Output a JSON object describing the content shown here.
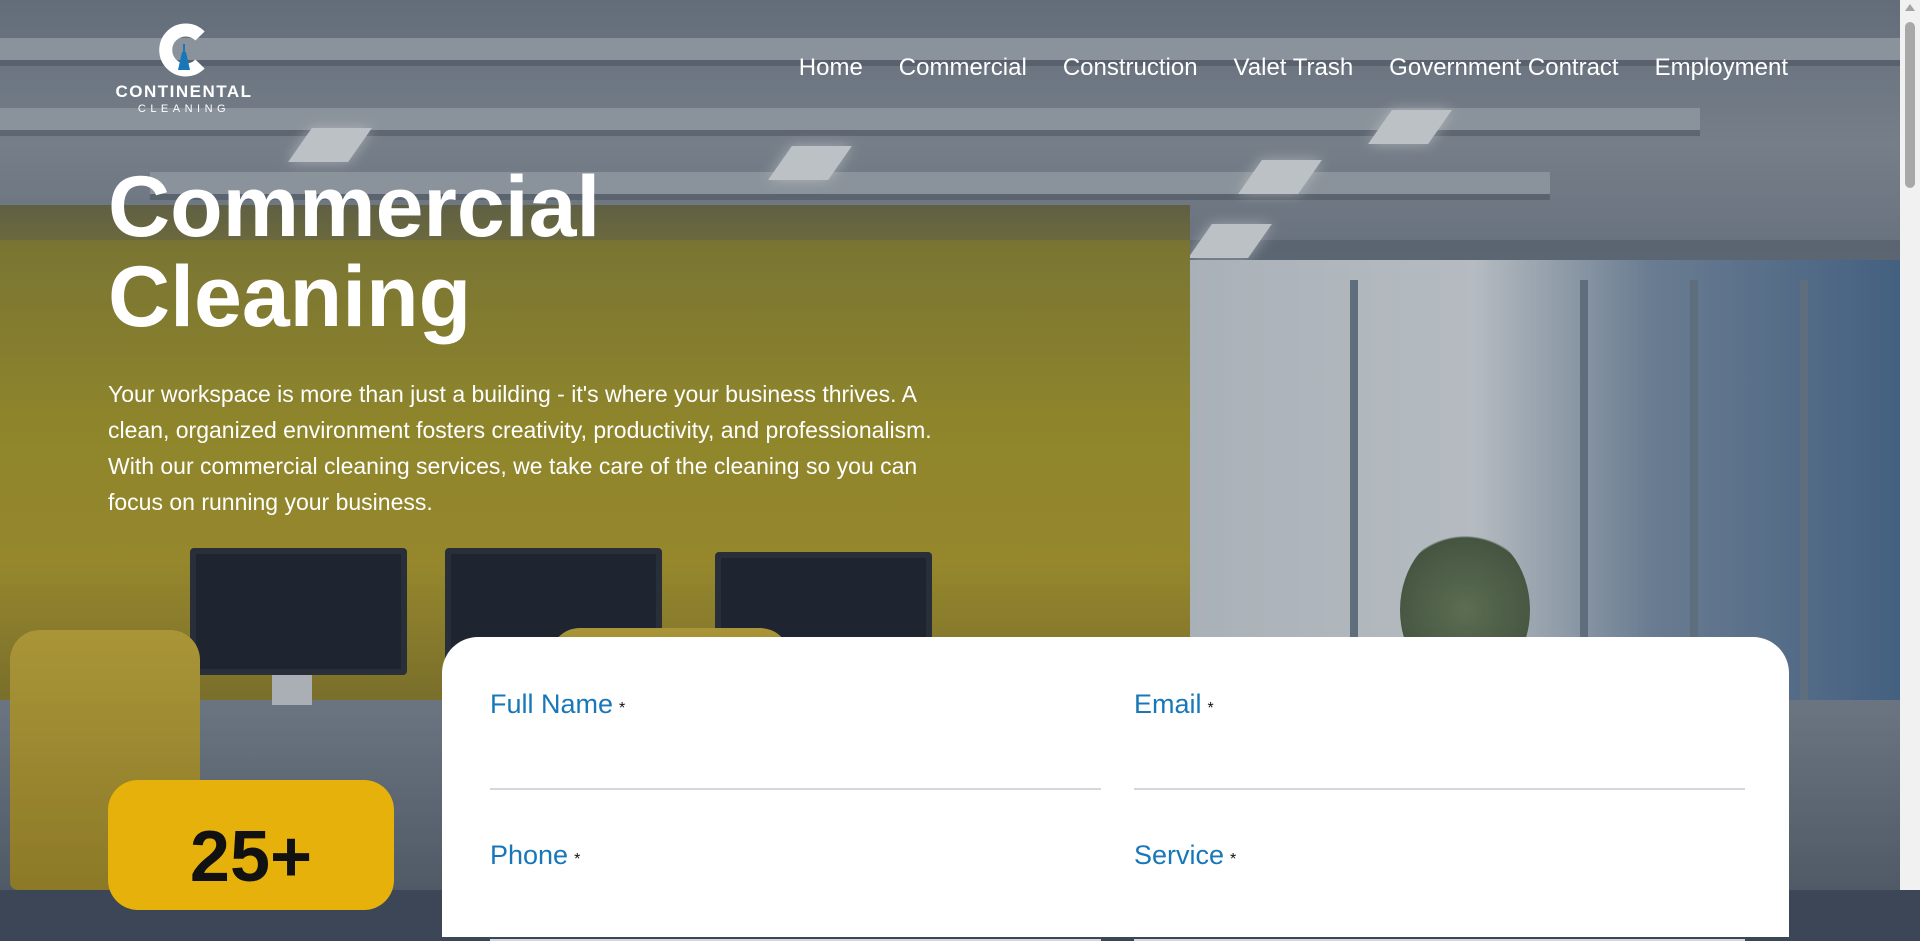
{
  "brand": {
    "name": "CONTINENTAL",
    "sub": "CLEANING",
    "accent_color": "#1877b8"
  },
  "nav": {
    "items": [
      {
        "label": "Home"
      },
      {
        "label": "Commercial"
      },
      {
        "label": "Construction"
      },
      {
        "label": "Valet Trash"
      },
      {
        "label": "Government Contract"
      },
      {
        "label": "Employment"
      }
    ]
  },
  "hero": {
    "title_line1": "Commercial",
    "title_line2": "Cleaning",
    "description": "Your workspace is more than just a building - it's where your business thrives. A clean, organized environment fosters creativity, productivity, and professionalism. With our commercial cleaning services, we take care of the cleaning so you can focus on running your business."
  },
  "stat": {
    "value": "25+",
    "color": "#e6b10a"
  },
  "form": {
    "required_marker": "*",
    "fields": [
      {
        "label": "Full Name",
        "value": ""
      },
      {
        "label": "Email",
        "value": ""
      },
      {
        "label": "Phone",
        "value": ""
      },
      {
        "label": "Service",
        "value": ""
      }
    ]
  }
}
